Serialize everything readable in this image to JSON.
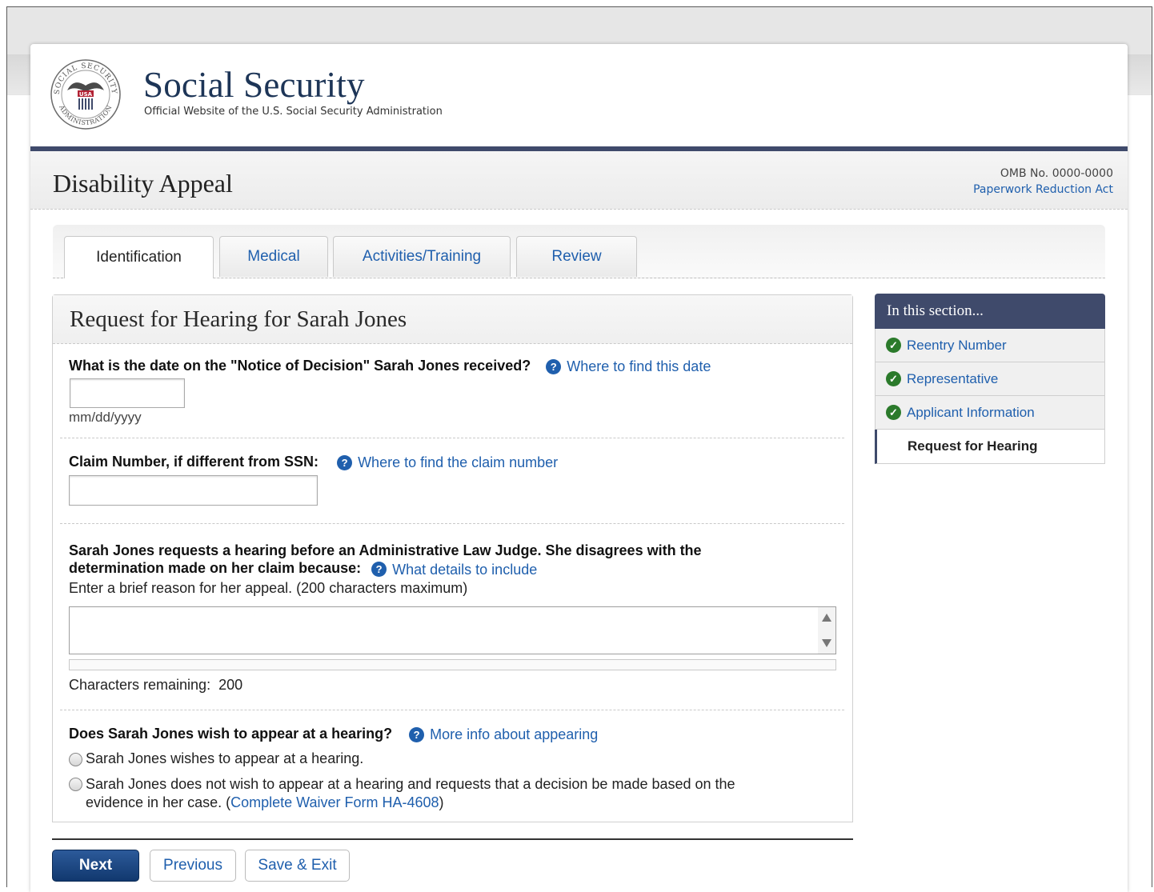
{
  "header": {
    "brand_title": "Social Security",
    "brand_subtitle": "Official Website of the U.S. Social Security Administration",
    "seal_text_top": "SOCIAL SECURITY",
    "seal_text_bottom": "ADMINISTRATION",
    "seal_badge": "USA"
  },
  "titlebar": {
    "title": "Disability Appeal",
    "omb": "OMB No. 0000-0000",
    "paperwork_link": "Paperwork Reduction Act"
  },
  "tabs": [
    {
      "label": "Identification",
      "active": true
    },
    {
      "label": "Medical",
      "active": false
    },
    {
      "label": "Activities/Training",
      "active": false
    },
    {
      "label": "Review",
      "active": false
    }
  ],
  "form": {
    "title": "Request for Hearing for Sarah Jones",
    "q1": {
      "label": "What is the date on the \"Notice of Decision\" Sarah Jones received?",
      "help": "Where to find this date",
      "value": "",
      "hint": "mm/dd/yyyy"
    },
    "q2": {
      "label": "Claim Number, if different from SSN:",
      "help": "Where to find the claim number",
      "value": ""
    },
    "q3": {
      "label_line1": "Sarah Jones requests a hearing before an Administrative Law Judge. She disagrees with the",
      "label_line2": "determination made on her claim because:",
      "help": "What details to include",
      "instruction": "Enter a brief reason for her appeal. (200 characters maximum)",
      "value": "",
      "chars_label": "Characters remaining:",
      "chars_remaining": "200"
    },
    "q4": {
      "label": "Does Sarah Jones wish to appear at a hearing?",
      "help": "More info about appearing",
      "option1": "Sarah Jones wishes to appear at a hearing.",
      "option2_line1": "Sarah Jones does not wish to appear at a hearing and requests that a decision be made based on the",
      "option2_line2_pre": "evidence in her case. (",
      "option2_link": "Complete Waiver Form HA-4608",
      "option2_line2_post": ")"
    }
  },
  "buttons": {
    "next": "Next",
    "previous": "Previous",
    "save_exit": "Save & Exit"
  },
  "sidebar": {
    "heading": "In this section...",
    "items": [
      {
        "label": "Reentry Number",
        "complete": true
      },
      {
        "label": "Representative",
        "complete": true
      },
      {
        "label": "Applicant Information",
        "complete": true
      },
      {
        "label": "Request for Hearing",
        "complete": false,
        "current": true
      }
    ]
  },
  "colors": {
    "brand_navy": "#3f4a6b",
    "link_blue": "#1f5fad",
    "check_green": "#2b7a2b"
  },
  "icons": [
    "seal-logo",
    "help-icon",
    "check-icon"
  ]
}
